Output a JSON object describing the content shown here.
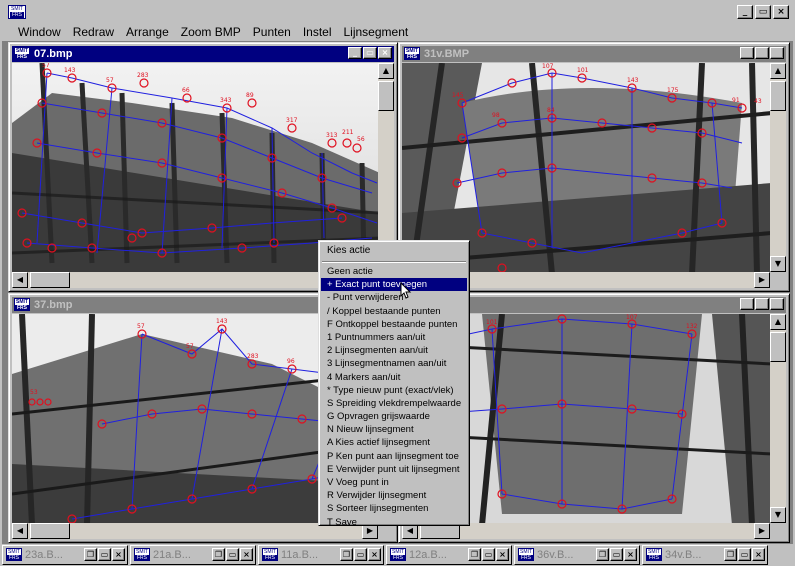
{
  "app": {
    "icon_text_top": "SMIT",
    "icon_text_bottom": "FRS",
    "caption_minimize": "_",
    "caption_maximize": "▭",
    "caption_close": "×"
  },
  "menu": {
    "items": [
      {
        "label": "Window"
      },
      {
        "label": "Redraw"
      },
      {
        "label": "Arrange"
      },
      {
        "label": "Zoom BMP"
      },
      {
        "label": "Punten"
      },
      {
        "label": "Instel"
      },
      {
        "label": "Lijnsegment"
      }
    ]
  },
  "windows": [
    {
      "title": "07.bmp",
      "active": true
    },
    {
      "title": "31v.BMP",
      "active": false
    },
    {
      "title": "37.bmp",
      "active": false
    },
    {
      "title": "",
      "active": false
    }
  ],
  "context_menu": {
    "header": "Kies actie",
    "items": [
      {
        "label": "Geen actie"
      },
      {
        "label": "+ Exact punt toevoegen"
      },
      {
        "label": "- Punt verwijderen"
      },
      {
        "label": "/ Koppel bestaande punten"
      },
      {
        "label": "F Ontkoppel bestaande punten"
      },
      {
        "label": "1 Puntnummers aan/uit"
      },
      {
        "label": "2 Lijnsegmenten aan/uit"
      },
      {
        "label": "3 Lijnsegmentnamen aan/uit"
      },
      {
        "label": "4 Markers aan/uit"
      },
      {
        "label": "* Type nieuw punt (exact/vlek)"
      },
      {
        "label": "S Spreiding vlekdrempelwaarde"
      },
      {
        "label": "G Opvragen grijswaarde"
      },
      {
        "label": "N Nieuw lijnsegment"
      },
      {
        "label": "A Kies actief lijnsegment"
      },
      {
        "label": "P Ken punt aan lijnsegment toe"
      },
      {
        "label": "E Verwijder punt uit lijnsegment"
      },
      {
        "label": "V Voeg punt in"
      },
      {
        "label": "R Verwijder lijnsegment"
      },
      {
        "label": "S Sorteer lijnsegmenten"
      },
      {
        "label": "T Save"
      }
    ]
  },
  "minimized": [
    {
      "title": "23a.B..."
    },
    {
      "title": "21a.B..."
    },
    {
      "title": "11a.B..."
    },
    {
      "title": "12a.B..."
    },
    {
      "title": "36v.B..."
    },
    {
      "title": "34v.B..."
    }
  ],
  "point_labels": {
    "w1": [
      "57",
      "143",
      "57",
      "283",
      "66",
      "343",
      "89",
      "317",
      "313",
      "211",
      "56"
    ],
    "w2": [
      "145",
      "107",
      "101",
      "143",
      "175",
      "91",
      "43",
      "98",
      "84"
    ],
    "w3": [
      "57",
      "143",
      "57",
      "283",
      "96",
      "343",
      "342",
      "53"
    ],
    "w4": [
      "17",
      "101",
      "107",
      "132",
      "115"
    ]
  },
  "colors": {
    "markers": "#e01020",
    "lines": "#2020e0",
    "active_title": "#000080",
    "inactive_title": "#808080",
    "highlight": "#000080"
  }
}
